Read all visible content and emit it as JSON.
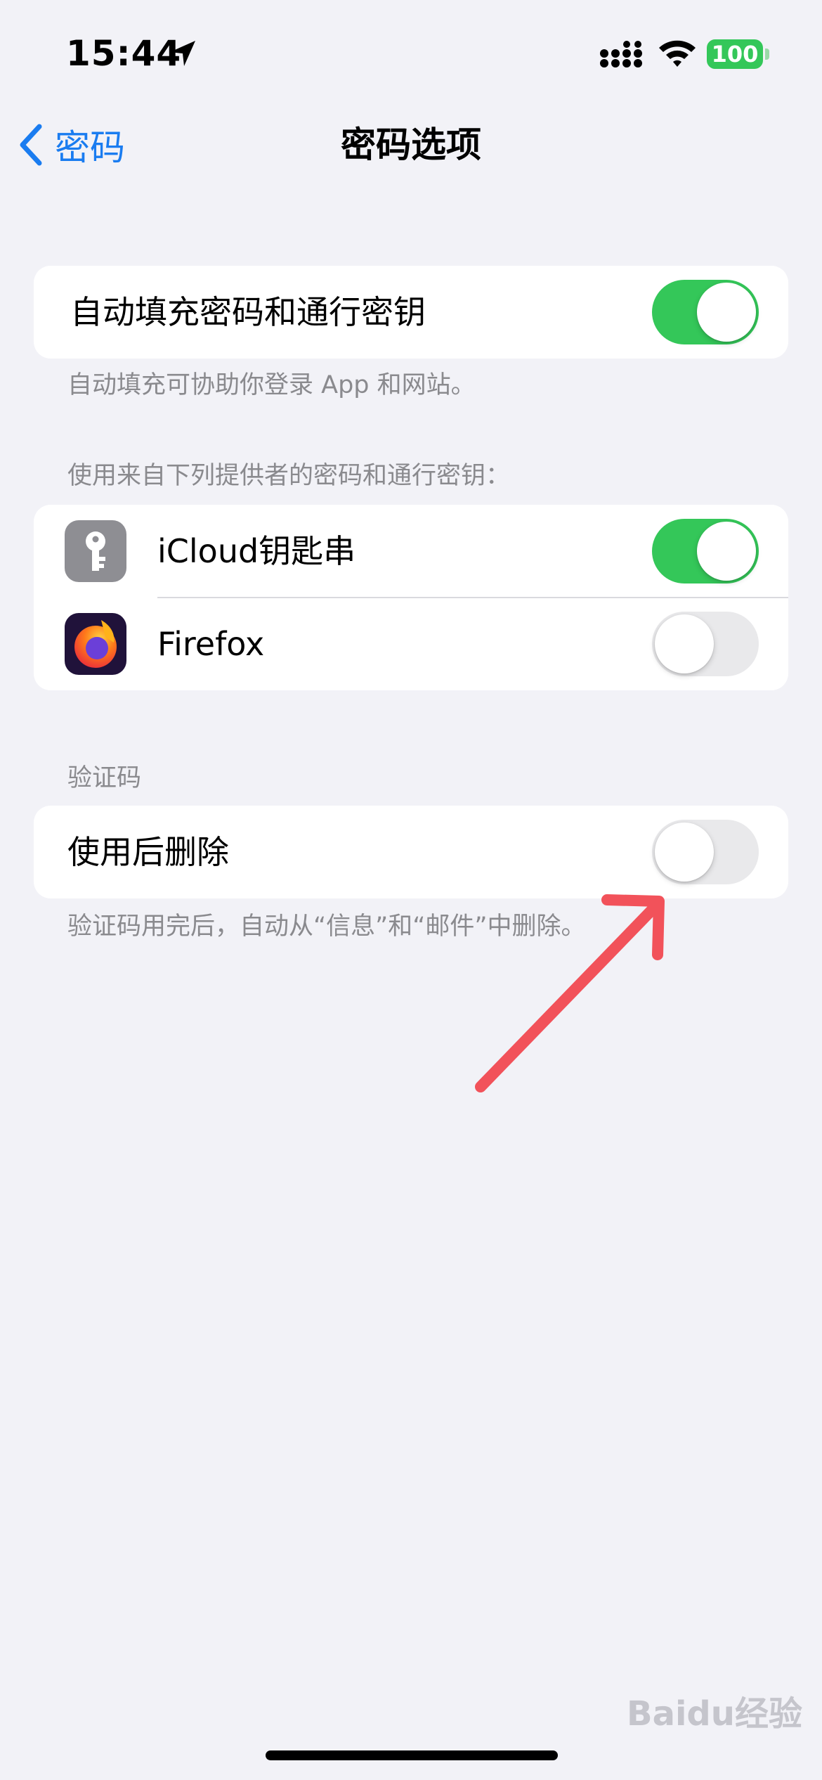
{
  "status_bar": {
    "time": "15:44",
    "battery": "100",
    "icons": [
      "location-arrow-icon",
      "signal-icon",
      "wifi-icon",
      "battery-icon"
    ]
  },
  "nav": {
    "back_label": "密码",
    "title": "密码选项"
  },
  "autofill": {
    "label": "自动填充密码和通行密钥",
    "enabled": true,
    "footer": "自动填充可协助你登录 App 和网站。"
  },
  "providers": {
    "header": "使用来自下列提供者的密码和通行密钥：",
    "items": [
      {
        "label": "iCloud钥匙串",
        "icon": "keychain-icon",
        "enabled": true
      },
      {
        "label": "Firefox",
        "icon": "firefox-icon",
        "enabled": false
      }
    ]
  },
  "verification": {
    "header": "验证码",
    "row_label": "使用后删除",
    "enabled": false,
    "footer": "验证码用完后，自动从“信息”和“邮件”中删除。"
  },
  "watermark": "Baidu经验",
  "colors": {
    "accent": "#1a7cf0",
    "toggle_on": "#34c759",
    "toggle_off": "#e9e9eb",
    "background": "#f2f2f7",
    "annotation_arrow": "#f2525a"
  }
}
